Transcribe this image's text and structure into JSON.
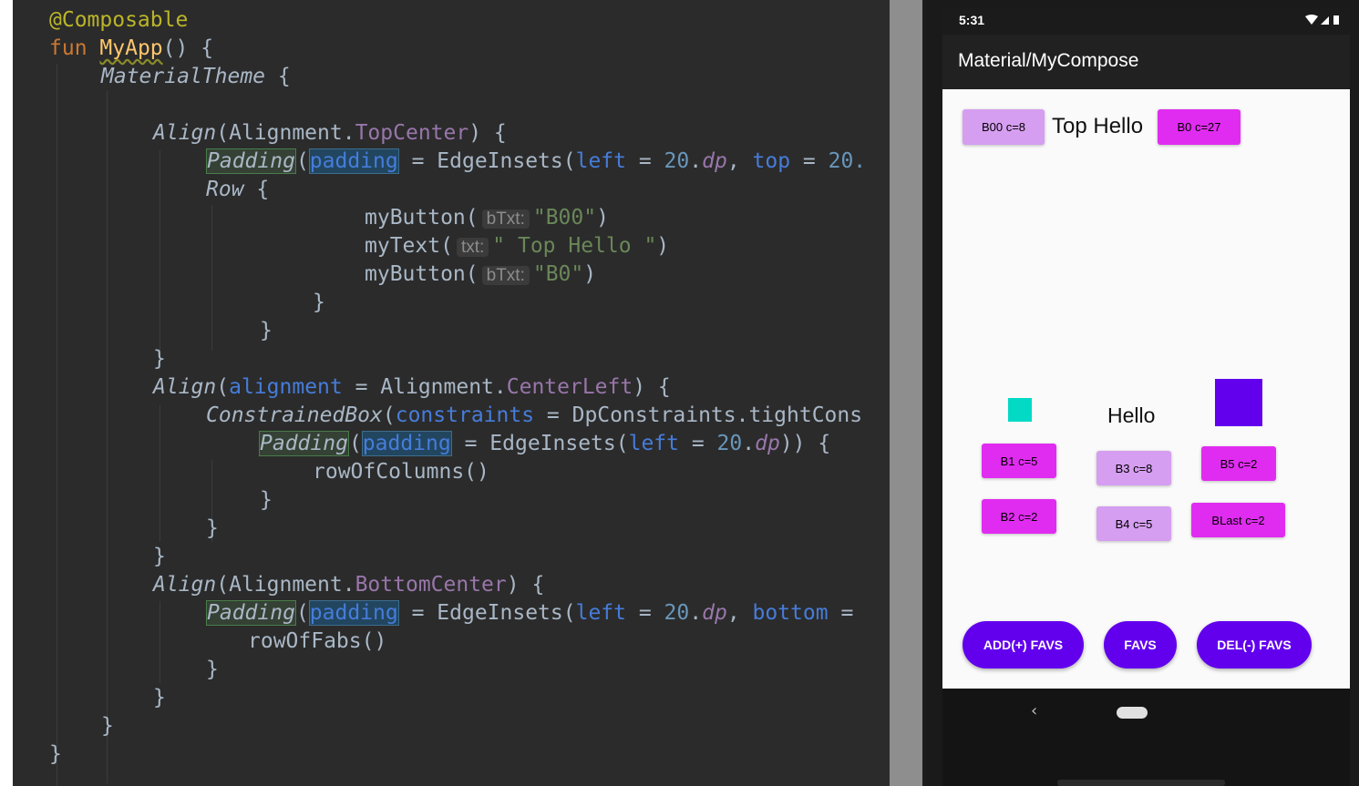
{
  "editor": {
    "line1": {
      "annotation": "@Composable"
    },
    "line2": {
      "keyword": "fun",
      "name": "MyApp",
      "rest": "() {"
    },
    "line3": {
      "call": "MaterialTheme",
      "rest": " {"
    },
    "line5": {
      "call": "Align",
      "p1": "(Alignment.",
      "arg": "TopCenter",
      "p2": ") {"
    },
    "line6": {
      "call": "Padding",
      "p1": "(",
      "param": "padding",
      "p2": " = EdgeInsets(",
      "n1": "left",
      "p3": " = ",
      "v1": "20",
      "p4": ".",
      "u1": "dp",
      "p5": ", ",
      "n2": "top",
      "p6": " = ",
      "v2": "20."
    },
    "line7": {
      "call": "Row",
      "rest": " {"
    },
    "line8": {
      "fn": "myButton(",
      "hint": "bTxt:",
      "str": "\"B00\"",
      "close": ")"
    },
    "line9": {
      "fn": "myText(",
      "hint": "txt:",
      "str": "\" Top Hello \"",
      "close": ")"
    },
    "line10": {
      "fn": "myButton(",
      "hint": "bTxt:",
      "str": "\"B0\"",
      "close": ")"
    },
    "line11": {
      "text": "}"
    },
    "line12": {
      "text": "}"
    },
    "line13": {
      "text": "}"
    },
    "line14": {
      "call": "Align",
      "p1": "(",
      "param": "alignment",
      "p2": " = Alignment.",
      "arg": "CenterLeft",
      "p3": ") {"
    },
    "line15": {
      "call": "ConstrainedBox",
      "p1": "(",
      "param": "constraints",
      "p2": " = DpConstraints.tightCons"
    },
    "line16": {
      "call": "Padding",
      "p1": "(",
      "param": "padding",
      "p2": " = EdgeInsets(",
      "n1": "left",
      "p3": " = ",
      "v1": "20",
      "p4": ".",
      "u1": "dp",
      "p5": ")) {"
    },
    "line17": {
      "text": "rowOfColumns()"
    },
    "line18": {
      "text": "}"
    },
    "line19": {
      "text": "}"
    },
    "line20": {
      "text": "}"
    },
    "line21": {
      "call": "Align",
      "p1": "(Alignment.",
      "arg": "BottomCenter",
      "p2": ") {"
    },
    "line22": {
      "call": "Padding",
      "p1": "(",
      "param": "padding",
      "p2": " = EdgeInsets(",
      "n1": "left",
      "p3": " = ",
      "v1": "20",
      "p4": ".",
      "u1": "dp",
      "p5": ", ",
      "n2": "bottom",
      "p6": " ="
    },
    "line23": {
      "text": "rowOfFabs()"
    },
    "line24": {
      "text": "}"
    },
    "line25": {
      "text": "}"
    },
    "line26": {
      "text": "}"
    },
    "line27": {
      "text": "}"
    }
  },
  "phone": {
    "status_time": "5:31",
    "app_title": "Material/MyCompose",
    "top_row": {
      "button1": "B00 c=8",
      "text": "Top Hello",
      "button2": "B0 c=27"
    },
    "center": {
      "text": "Hello"
    },
    "buttons": {
      "b1": "B1 c=5",
      "b2": "B2 c=2",
      "b3": "B3 c=8",
      "b4": "B4 c=5",
      "b5": "B5 c=2",
      "blast": "BLast c=2"
    },
    "fabs": {
      "add": "ADD(+) FAVS",
      "favs": "FAVS",
      "del": "DEL(-) FAVS"
    },
    "nav": {
      "back": "‹"
    }
  },
  "colors": {
    "editor_bg": "#2b2b2b",
    "keyword": "#cc7832",
    "annotation": "#bbb529",
    "string": "#6a8759",
    "number": "#6897bb",
    "param": "#467cda",
    "property": "#9876aa",
    "button_light": "#d59ef0",
    "button_magenta": "#e02cf0",
    "teal_box": "#03dac5",
    "purple_box": "#6200ee",
    "fab": "#6200ee"
  },
  "icons": {
    "wifi": "wifi-icon",
    "signal": "signal-icon",
    "battery": "battery-icon",
    "home": "home-pill-icon",
    "back": "back-arrow-icon"
  }
}
